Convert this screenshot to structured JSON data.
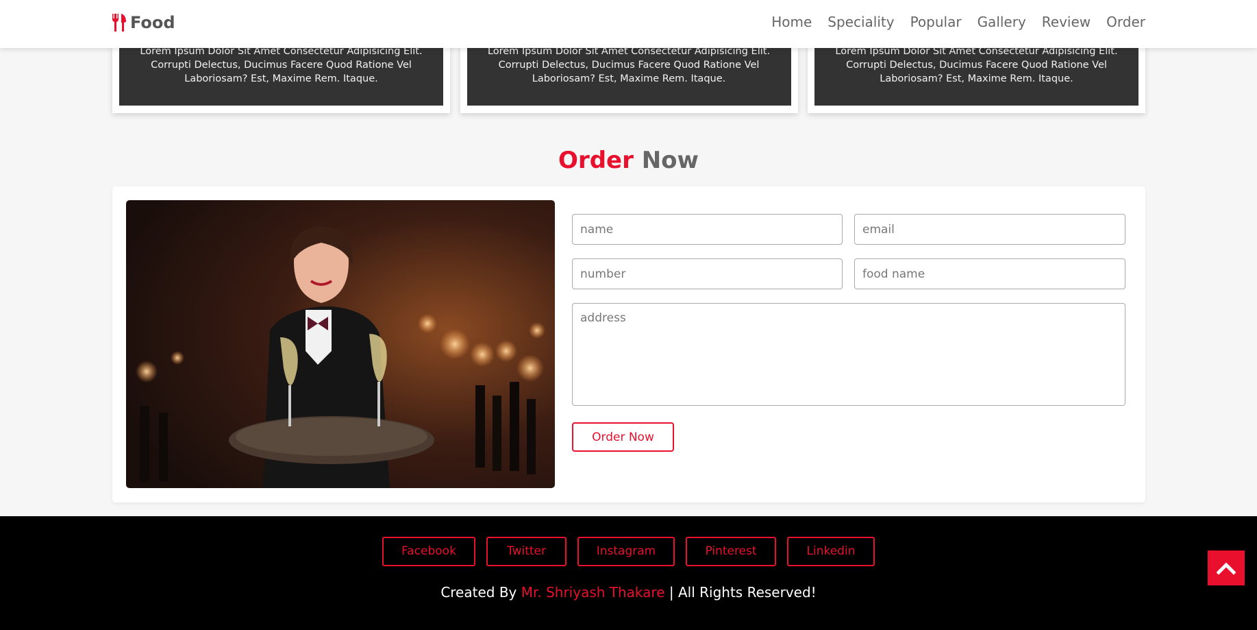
{
  "header": {
    "logo_text": "Food",
    "nav": [
      "Home",
      "Speciality",
      "Popular",
      "Gallery",
      "Review",
      "Order"
    ]
  },
  "cards": [
    {
      "text": "Lorem Ipsum Dolor Sit Amet Consectetur Adipisicing Elit. Corrupti Delectus, Ducimus Facere Quod Ratione Vel Laboriosam? Est, Maxime Rem. Itaque."
    },
    {
      "text": "Lorem Ipsum Dolor Sit Amet Consectetur Adipisicing Elit. Corrupti Delectus, Ducimus Facere Quod Ratione Vel Laboriosam? Est, Maxime Rem. Itaque."
    },
    {
      "text": "Lorem Ipsum Dolor Sit Amet Consectetur Adipisicing Elit. Corrupti Delectus, Ducimus Facere Quod Ratione Vel Laboriosam? Est, Maxime Rem. Itaque."
    }
  ],
  "order": {
    "heading_accent": "Order",
    "heading_rest": " Now",
    "placeholders": {
      "name": "name",
      "email": "email",
      "number": "number",
      "food_name": "food name",
      "address": "address"
    },
    "button_label": "Order Now"
  },
  "footer": {
    "social": [
      "Facebook",
      "Twitter",
      "Instagram",
      "Pinterest",
      "Linkedin"
    ],
    "credit_prefix": "Created By ",
    "credit_name": "Mr. Shriyash Thakare",
    "credit_suffix": " | All Rights Reserved!"
  },
  "colors": {
    "accent": "#e8102d",
    "footer_bg": "#000000",
    "card_bg": "#333333",
    "page_bg": "#f6f6f6"
  },
  "icons": {
    "logo": "utensils-icon",
    "scroll_top": "chevron-up-icon"
  }
}
